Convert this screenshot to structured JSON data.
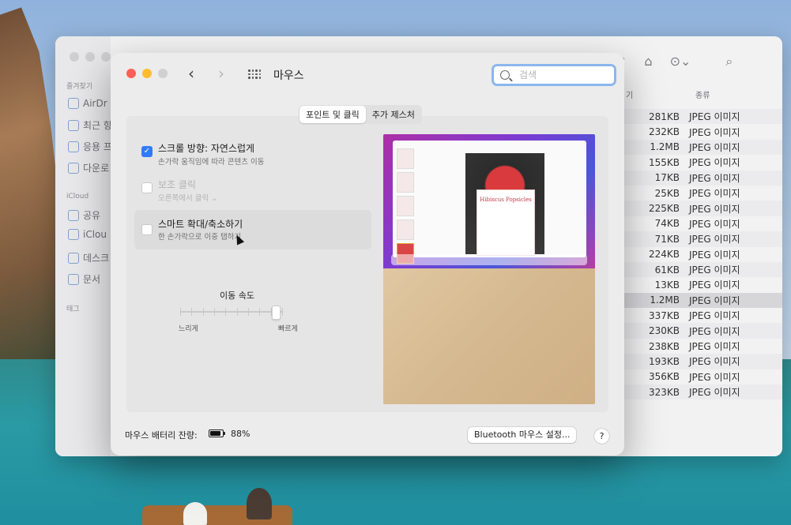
{
  "finder": {
    "sections": {
      "favorites": "즐겨찾기",
      "icloud": "iCloud",
      "tags": "태그"
    },
    "sidebar": {
      "favorites": [
        "AirDr",
        "최근 항",
        "응용 프",
        "다운로"
      ],
      "icloud": [
        "공유",
        "iClou",
        "데스크",
        "문서"
      ]
    },
    "columns": {
      "size_partial": "기",
      "kind": "종류"
    },
    "files": [
      {
        "size": "281KB",
        "kind": "JPEG 이미지"
      },
      {
        "size": "232KB",
        "kind": "JPEG 이미지"
      },
      {
        "size": "1.2MB",
        "kind": "JPEG 이미지"
      },
      {
        "size": "155KB",
        "kind": "JPEG 이미지"
      },
      {
        "size": "17KB",
        "kind": "JPEG 이미지"
      },
      {
        "size": "25KB",
        "kind": "JPEG 이미지"
      },
      {
        "size": "225KB",
        "kind": "JPEG 이미지"
      },
      {
        "size": "74KB",
        "kind": "JPEG 이미지"
      },
      {
        "size": "71KB",
        "kind": "JPEG 이미지"
      },
      {
        "size": "224KB",
        "kind": "JPEG 이미지"
      },
      {
        "size": "61KB",
        "kind": "JPEG 이미지"
      },
      {
        "size": "13KB",
        "kind": "JPEG 이미지"
      },
      {
        "size": "1.2MB",
        "kind": "JPEG 이미지"
      },
      {
        "size": "337KB",
        "kind": "JPEG 이미지"
      },
      {
        "size": "230KB",
        "kind": "JPEG 이미지"
      },
      {
        "size": "238KB",
        "kind": "JPEG 이미지"
      },
      {
        "size": "193KB",
        "kind": "JPEG 이미지"
      },
      {
        "size": "356KB",
        "kind": "JPEG 이미지"
      },
      {
        "size": "323KB",
        "kind": "JPEG 이미지"
      }
    ],
    "selected_row": 12
  },
  "window": {
    "title": "마우스",
    "search_placeholder": "검색",
    "nav": {
      "back": "‹",
      "forward": "›"
    }
  },
  "tabs": [
    {
      "label": "포인트 및 클릭",
      "active": true
    },
    {
      "label": "추가 제스처",
      "active": false
    }
  ],
  "options": [
    {
      "title": "스크롤 방향: 자연스럽게",
      "subtitle": "손가락 움직임에 따라 콘텐츠 이동",
      "checked": true,
      "dimmed": false
    },
    {
      "title": "보조 클릭",
      "subtitle": "오른쪽에서 클릭 ⌄",
      "checked": false,
      "dimmed": true
    },
    {
      "title": "스마트 확대/축소하기",
      "subtitle": "한 손가락으로 이중 탭하기",
      "checked": false,
      "dimmed": false,
      "highlighted": true
    }
  ],
  "tracking": {
    "label": "이동 속도",
    "min_label": "느리게",
    "max_label": "빠르게",
    "value_fraction": 0.92
  },
  "preview": {
    "card_title": "Hibiscus Popsicles"
  },
  "footer": {
    "battery_label": "마우스 배터리 잔량:",
    "battery_value": "88%",
    "bluetooth_button": "Bluetooth 마우스 설정...",
    "help_button": "?"
  }
}
